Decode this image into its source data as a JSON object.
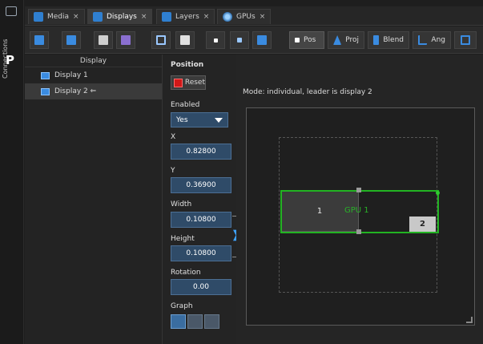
{
  "sidebar": {
    "vertical_label": "Connections",
    "logo_letter": "P"
  },
  "tabs": [
    {
      "label": "Media",
      "close": "×"
    },
    {
      "label": "Displays",
      "close": "×"
    },
    {
      "label": "Layers",
      "close": "×"
    },
    {
      "label": "GPUs",
      "close": "×"
    }
  ],
  "toolbar": {
    "pos_label": "Pos",
    "proj_label": "Proj",
    "blend_label": "Blend",
    "ang_label": "Ang"
  },
  "display_list": {
    "header": "Display",
    "items": [
      "Display 1",
      "Display 2 ⇐"
    ]
  },
  "properties": {
    "position_heading": "Position",
    "reset_label": "Reset",
    "enabled_label": "Enabled",
    "enabled_value": "Yes",
    "x_label": "X",
    "x_value": "0.82800",
    "y_label": "Y",
    "y_value": "0.36900",
    "width_label": "Width",
    "width_value": "0.10800",
    "height_label": "Height",
    "height_value": "0.10800",
    "rotation_label": "Rotation",
    "rotation_value": "0.00",
    "graph_label": "Graph"
  },
  "mapping": {
    "mode_text": "Mode: individual, leader is display 2",
    "display1_label": "1",
    "gpu_label": "GPU 1",
    "display2_label": "2"
  },
  "colors": {
    "accent": "#3a8be0",
    "gpu_outline": "#22b322",
    "reset_red": "#d01818"
  }
}
